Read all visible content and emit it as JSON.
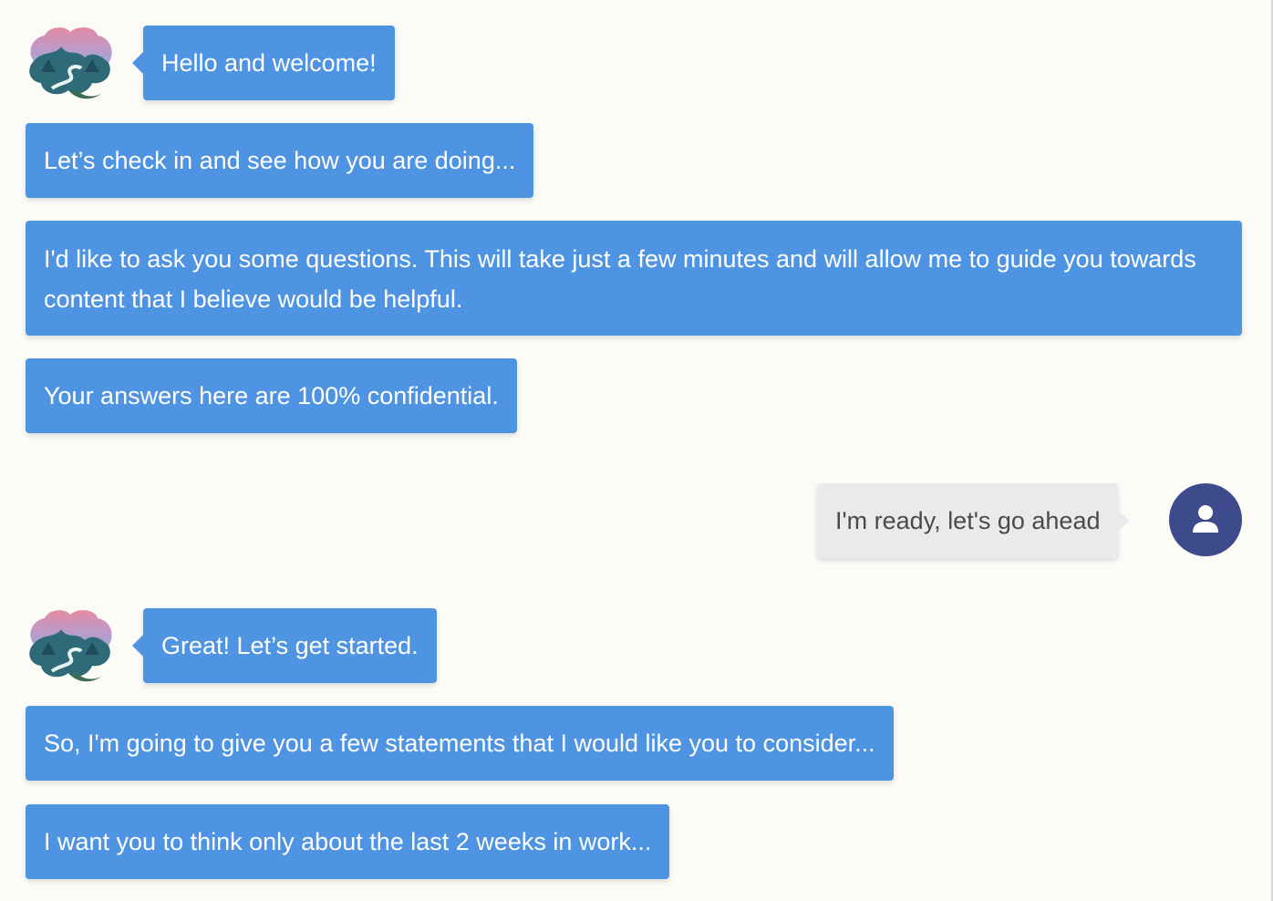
{
  "conversation": {
    "messages": [
      {
        "sender": "bot",
        "text": "Hello and welcome!"
      },
      {
        "sender": "bot",
        "text": "Let’s check in and see how you are doing..."
      },
      {
        "sender": "bot",
        "text": "I'd like to ask you some questions. This will take just a few minutes and will allow me to guide you towards content that I believe would be helpful."
      },
      {
        "sender": "bot",
        "text": "Your answers here are 100% confidential."
      },
      {
        "sender": "user",
        "text": "I'm ready, let's go ahead"
      },
      {
        "sender": "bot",
        "text": "Great! Let’s get started."
      },
      {
        "sender": "bot",
        "text": "So, I'm going to give you a few statements that I would like you to consider..."
      },
      {
        "sender": "bot",
        "text": "I want you to think only about the last 2 weeks in work..."
      }
    ]
  },
  "icons": {
    "bot_avatar": "brain-landscape-icon",
    "user_avatar": "user-icon"
  },
  "colors": {
    "background": "#fcfbf7",
    "bot_bubble": "#4f94e3",
    "user_bubble": "#e9eaec",
    "user_avatar": "#3d4a8c"
  }
}
